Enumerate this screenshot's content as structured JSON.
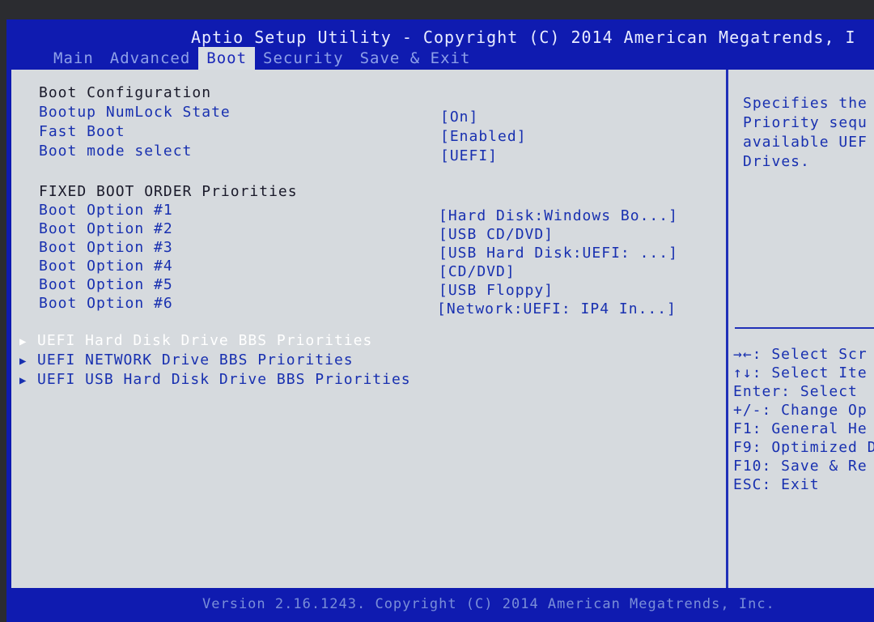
{
  "title": "Aptio Setup Utility - Copyright (C) 2014 American Megatrends, I",
  "tabs": [
    {
      "label": "Main"
    },
    {
      "label": "Advanced"
    },
    {
      "label": "Boot"
    },
    {
      "label": "Security"
    },
    {
      "label": "Save & Exit"
    }
  ],
  "boot_config": {
    "heading": "Boot Configuration",
    "numlock_label": "Bootup NumLock State",
    "numlock_value": "[On]",
    "fastboot_label": "Fast Boot",
    "fastboot_value": "[Enabled]",
    "bootmode_label": "Boot mode select",
    "bootmode_value": "[UEFI]"
  },
  "fixed_order": {
    "heading": "FIXED BOOT ORDER Priorities",
    "options": [
      {
        "label": "Boot Option #1",
        "value": "[Hard Disk:Windows Bo...]"
      },
      {
        "label": "Boot Option #2",
        "value": "[USB CD/DVD]"
      },
      {
        "label": "Boot Option #3",
        "value": "[USB Hard Disk:UEFI: ...]"
      },
      {
        "label": "Boot Option #4",
        "value": "[CD/DVD]"
      },
      {
        "label": "Boot Option #5",
        "value": "[USB Floppy]"
      },
      {
        "label": "Boot Option #6",
        "value": "[Network:UEFI: IP4 In...]"
      }
    ]
  },
  "submenus": [
    {
      "label": "UEFI Hard Disk Drive BBS Priorities"
    },
    {
      "label": "UEFI NETWORK Drive BBS Priorities"
    },
    {
      "label": "UEFI USB Hard Disk Drive BBS Priorities"
    }
  ],
  "help": {
    "text": "Specifies the\nPriority sequ\navailable UEF\nDrives."
  },
  "keys": [
    {
      "text": "→←: Select Scr"
    },
    {
      "text": "↑↓: Select Ite"
    },
    {
      "text": "Enter: Select"
    },
    {
      "text": "+/-: Change Op"
    },
    {
      "text": "F1: General He"
    },
    {
      "text": "F9: Optimized D"
    },
    {
      "text": "F10: Save & Re"
    },
    {
      "text": "ESC: Exit"
    }
  ],
  "footer": "Version 2.16.1243. Copyright (C) 2014 American Megatrends, Inc.",
  "colors": {
    "frame": "#0f1bb0",
    "panel": "#d6dade",
    "text_blue": "#1830b0",
    "selected": "#ffffff"
  },
  "icons": {
    "submenu_arrow": "triangle-right-icon"
  }
}
